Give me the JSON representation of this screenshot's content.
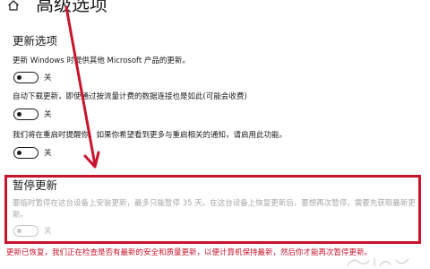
{
  "header": {
    "title": "高级选项"
  },
  "update_options": {
    "heading": "更新选项",
    "settings": [
      {
        "description": "更新 Windows 时提供其他 Microsoft 产品的更新。",
        "state": "关"
      },
      {
        "description": "自动下载更新，即使通过按流量计费的数据连接也是如此(可能会收费)",
        "state": "关"
      },
      {
        "description": "我们将在重启时提醒你。如果你希望看到更多与重启相关的通知，请启用此功能。",
        "state": "关"
      }
    ]
  },
  "pause_updates": {
    "heading": "暂停更新",
    "description": "要临时暂停在这台设备上安装更新，最多只能暂停 35 天。在这台设备上恢复更新后，要想再次暂停，需要先获取最新更新。",
    "state": "关"
  },
  "annotation": {
    "note": "更新已恢复，我们正在检查是否有最新的安全和质量更新，以便计算机保持最新，然后你才能再次暂停更新。",
    "color": "#c8142c"
  },
  "colors": {
    "highlight": "#c8142c",
    "text": "#1a1a1a",
    "disabled": "#a6a6a6"
  },
  "icons": {
    "home": "home-icon"
  }
}
